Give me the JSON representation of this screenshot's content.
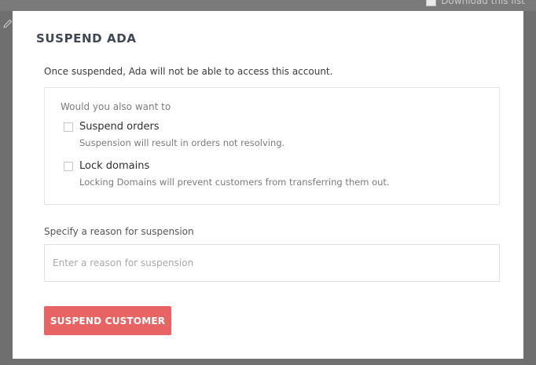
{
  "background": {
    "download_label": "Download this list"
  },
  "modal": {
    "title": "SUSPEND ADA",
    "description": "Once suspended, Ada will not be able to access this account.",
    "options_prompt": "Would you also want to",
    "options": [
      {
        "label": "Suspend orders",
        "help": "Suspension will result in orders not resolving.",
        "checked": false
      },
      {
        "label": "Lock domains",
        "help": "Locking Domains will prevent customers from transferring them out.",
        "checked": false
      }
    ],
    "reason_label": "Specify a reason for suspension",
    "reason_placeholder": "Enter a reason for suspension",
    "reason_value": "",
    "submit_label": "SUSPEND CUSTOMER"
  },
  "colors": {
    "overlay": "#6f6f6f",
    "title": "#3f4654",
    "button": "#e86464",
    "button_text": "#ffffff"
  },
  "icons": {
    "edit": "pencil-icon"
  }
}
